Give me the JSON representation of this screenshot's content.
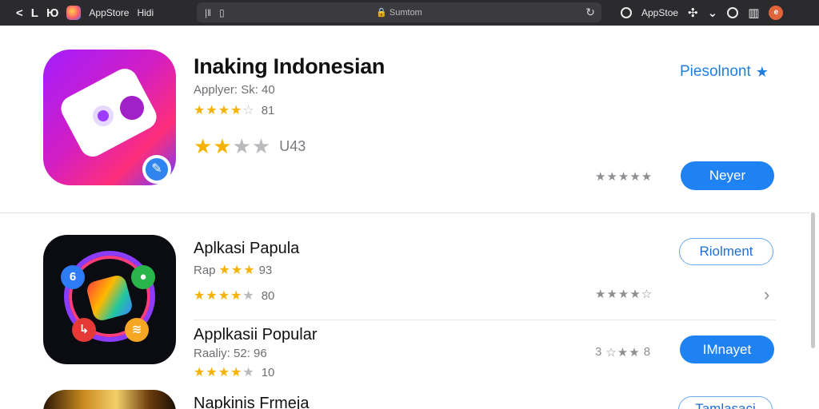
{
  "topbar": {
    "nav_back": "<",
    "nav_l": "L",
    "nav_refresh_glyph": "Ю",
    "tab_label": "AppStore",
    "tab_extra": "Hidi",
    "address_icon_1": "|‖",
    "address_icon_2": "▯",
    "address_text": "Sumtom",
    "right_label": "AppStoe",
    "right_icons": [
      "atom-icon",
      "puzzle-icon",
      "chevron-down-icon",
      "circle-icon",
      "reader-icon",
      "avatar"
    ]
  },
  "featured": {
    "title": "Inaking Indonesian",
    "subtitle": "Applyer: Sk: 40",
    "rating_small_count": "81",
    "rating_big_count": "U43",
    "link_label": "Piesolnont",
    "button_label": "Neyer",
    "colors": {
      "accent": "#1f82f2",
      "link": "#1f7fe0",
      "star": "#f5b301"
    }
  },
  "apps": [
    {
      "title": "Aplkasi Papula",
      "subtitle_prefix": "Rap",
      "subtitle_count": "93",
      "rating_count": "80",
      "button_label": "Riolment",
      "button_style": "outline"
    },
    {
      "title": "Applkasii Popular",
      "subtitle": "Raaliy: 52: 96",
      "rating_count": "10",
      "right_prefix": "3",
      "right_count": "8",
      "button_label": "IMnayet",
      "button_style": "solid"
    },
    {
      "title": "Napkinis Frmeja",
      "button_label": "Tamlasaci",
      "button_style": "outline"
    }
  ]
}
